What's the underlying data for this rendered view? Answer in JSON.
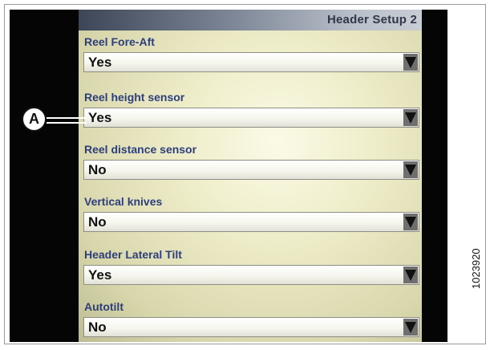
{
  "screen": {
    "title": "Header Setup 2",
    "settings": [
      {
        "label": "Reel Fore-Aft",
        "value": "Yes"
      },
      {
        "label": "Reel height sensor",
        "value": "Yes"
      },
      {
        "label": "Reel distance sensor",
        "value": "No"
      },
      {
        "label": "Vertical knives",
        "value": "No"
      },
      {
        "label": "Header Lateral Tilt",
        "value": "Yes"
      },
      {
        "label": "Autotilt",
        "value": "No"
      }
    ]
  },
  "callout": {
    "letter": "A"
  },
  "figure": {
    "reference_number": "1023920"
  }
}
